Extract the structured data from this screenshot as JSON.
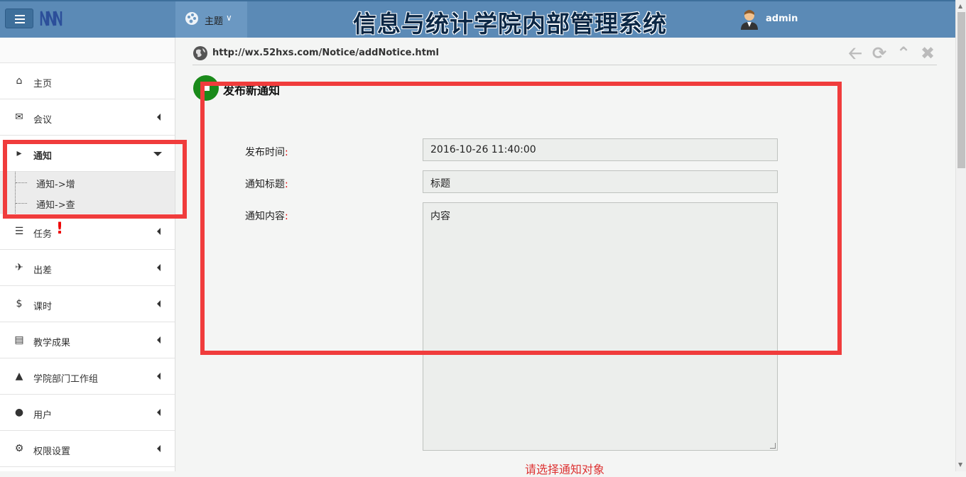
{
  "header": {
    "system_title": "信息与统计学院内部管理系统",
    "theme_label": "主题",
    "user_name": "admin"
  },
  "sidebar": {
    "items": [
      {
        "label": "主页",
        "icon": "home-icon"
      },
      {
        "label": "会议",
        "icon": "comments-icon"
      },
      {
        "label": "通知",
        "icon": "bullhorn-icon",
        "expanded": true,
        "children": [
          {
            "label": "通知->增"
          },
          {
            "label": "通知->查"
          }
        ]
      },
      {
        "label": "任务",
        "icon": "tasks-icon",
        "alert": "!"
      },
      {
        "label": "出差",
        "icon": "plane-icon"
      },
      {
        "label": "课时",
        "icon": "dollar-icon"
      },
      {
        "label": "教学成果",
        "icon": "bar-chart-icon"
      },
      {
        "label": "学院部门工作组",
        "icon": "institution-icon"
      },
      {
        "label": "用户",
        "icon": "user-icon"
      },
      {
        "label": "权限设置",
        "icon": "gear-icon"
      }
    ]
  },
  "breadcrumb": {
    "url": "http://wx.52hxs.com/Notice/addNotice.html"
  },
  "form": {
    "title": "发布新通知",
    "fields": {
      "time_label": "发布时间",
      "time_value": "2016-10-26 11:40:00",
      "title_label": "通知标题",
      "title_value": "标题",
      "content_label": "通知内容",
      "content_value": "内容",
      "colon": ":"
    },
    "target_hint": "请选择通知对象"
  },
  "colors": {
    "topbar": "#5b8ab6",
    "annotation": "#f03c3c",
    "alert": "#e00000"
  }
}
